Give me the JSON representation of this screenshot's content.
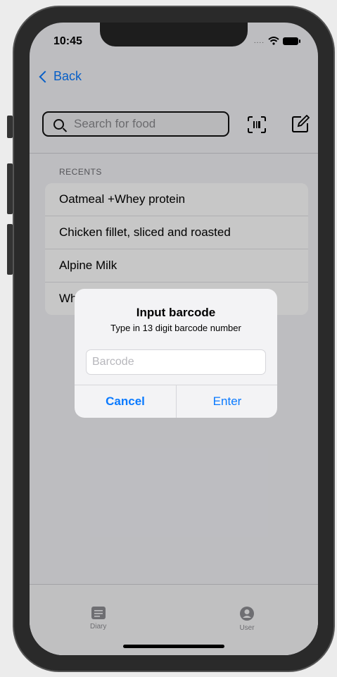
{
  "status": {
    "time": "10:45",
    "signal": "...."
  },
  "nav": {
    "back_label": "Back"
  },
  "search": {
    "placeholder": "Search for food"
  },
  "recents": {
    "label": "RECENTS",
    "items": [
      "Oatmeal +Whey protein",
      "Chicken fillet, sliced and roasted",
      "Alpine Milk",
      "Wh"
    ]
  },
  "alert": {
    "title": "Input barcode",
    "message": "Type in 13 digit barcode number",
    "input_placeholder": "Barcode",
    "cancel_label": "Cancel",
    "enter_label": "Enter"
  },
  "tabs": [
    {
      "label": "Diary",
      "icon": "diary-icon"
    },
    {
      "label": "User",
      "icon": "user-icon"
    }
  ],
  "colors": {
    "accent": "#0a7aff",
    "tab_inactive": "#8e8e93"
  }
}
